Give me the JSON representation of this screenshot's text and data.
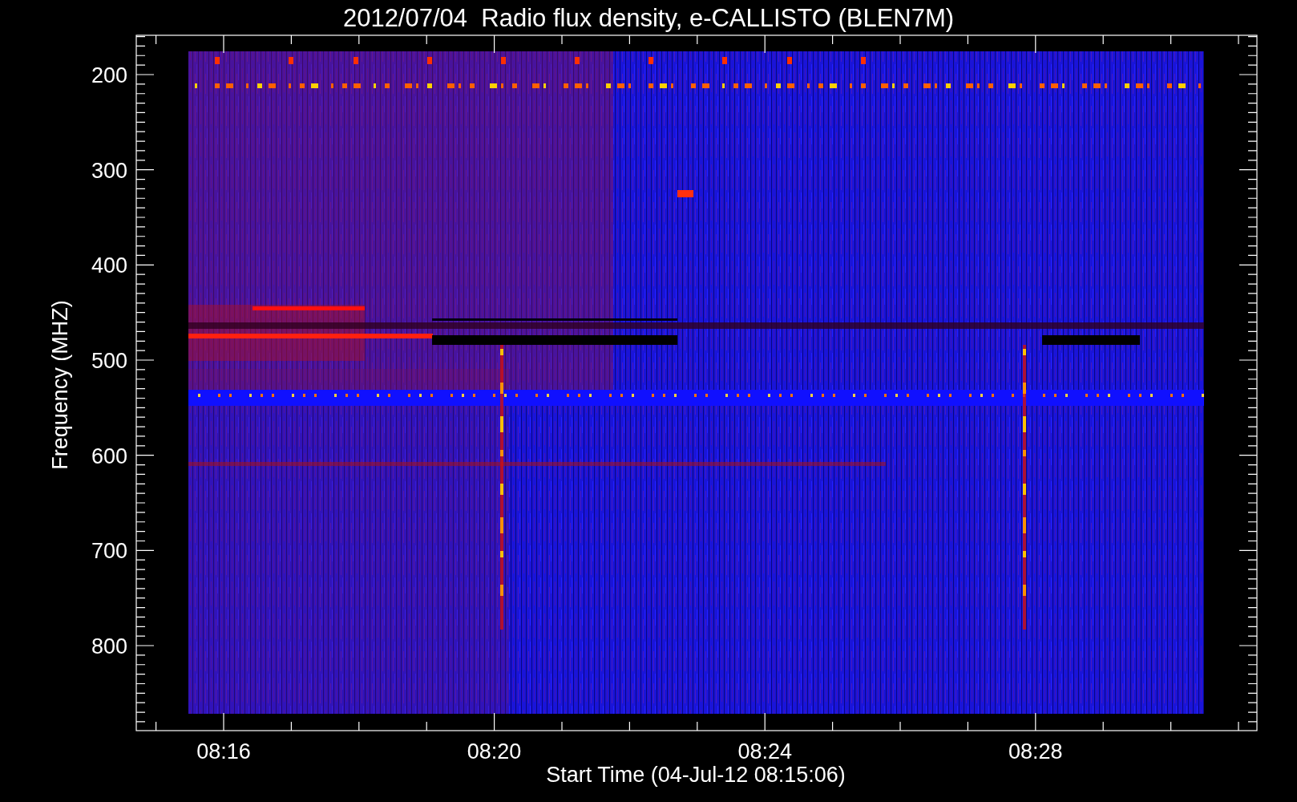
{
  "title": "2012/07/04  Radio flux density, e-CALLISTO (BLEN7M)",
  "y_axis": {
    "label": "Frequency (MHZ)",
    "ticks": [
      "200",
      "300",
      "400",
      "500",
      "600",
      "700",
      "800"
    ]
  },
  "x_axis": {
    "label": "Start Time (04-Jul-12 08:15:06)",
    "ticks": [
      "08:16",
      "08:20",
      "08:24",
      "08:28"
    ]
  }
}
